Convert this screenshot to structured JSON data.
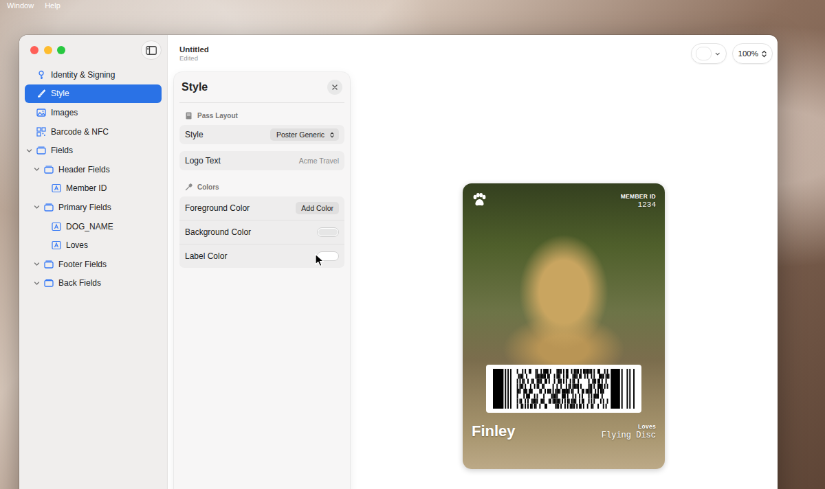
{
  "menu_bar": {
    "items": [
      "Window",
      "Help"
    ]
  },
  "window": {
    "title": "Untitled",
    "subtitle": "Edited"
  },
  "sidebar": {
    "items": [
      {
        "label": "Identity & Signing",
        "level": 0,
        "kind": "identity",
        "selected": false
      },
      {
        "label": "Style",
        "level": 0,
        "kind": "style",
        "selected": true
      },
      {
        "label": "Images",
        "level": 0,
        "kind": "images",
        "selected": false
      },
      {
        "label": "Barcode & NFC",
        "level": 0,
        "kind": "barcode",
        "selected": false
      },
      {
        "label": "Fields",
        "level": 0,
        "kind": "group",
        "expanded": true,
        "selected": false
      },
      {
        "label": "Header Fields",
        "level": 1,
        "kind": "group",
        "expanded": true,
        "selected": false
      },
      {
        "label": "Member ID",
        "level": 2,
        "kind": "field",
        "selected": false
      },
      {
        "label": "Primary Fields",
        "level": 1,
        "kind": "group",
        "expanded": true,
        "selected": false
      },
      {
        "label": "DOG_NAME",
        "level": 2,
        "kind": "field",
        "selected": false
      },
      {
        "label": "Loves",
        "level": 2,
        "kind": "field",
        "selected": false
      },
      {
        "label": "Footer Fields",
        "level": 1,
        "kind": "group",
        "expanded": true,
        "selected": false
      },
      {
        "label": "Back Fields",
        "level": 1,
        "kind": "group",
        "expanded": true,
        "selected": false
      }
    ]
  },
  "toolbar": {
    "zoom": "100%"
  },
  "inspector": {
    "title": "Style",
    "sections": [
      {
        "title": "Pass Layout",
        "kind": "layout",
        "groups": [
          [
            {
              "label": "Style",
              "kind": "select",
              "value": "Poster Generic"
            }
          ],
          [
            {
              "label": "Logo Text",
              "kind": "text",
              "placeholder": "Acme Travel"
            }
          ]
        ]
      },
      {
        "title": "Colors",
        "kind": "colors",
        "groups": [
          [
            {
              "label": "Foreground Color",
              "kind": "button",
              "button": "Add Color"
            },
            {
              "label": "Background Color",
              "kind": "color",
              "color": "#e6e6e6"
            },
            {
              "label": "Label Color",
              "kind": "color",
              "color": "#ffffff"
            }
          ]
        ]
      }
    ]
  },
  "pass": {
    "header_fields": [
      {
        "label": "MEMBER ID",
        "value": "1234"
      }
    ],
    "primary_fields": [
      {
        "value": "Finley"
      }
    ],
    "secondary_fields": [
      {
        "label": "Loves",
        "value": "Flying Disc"
      }
    ]
  }
}
